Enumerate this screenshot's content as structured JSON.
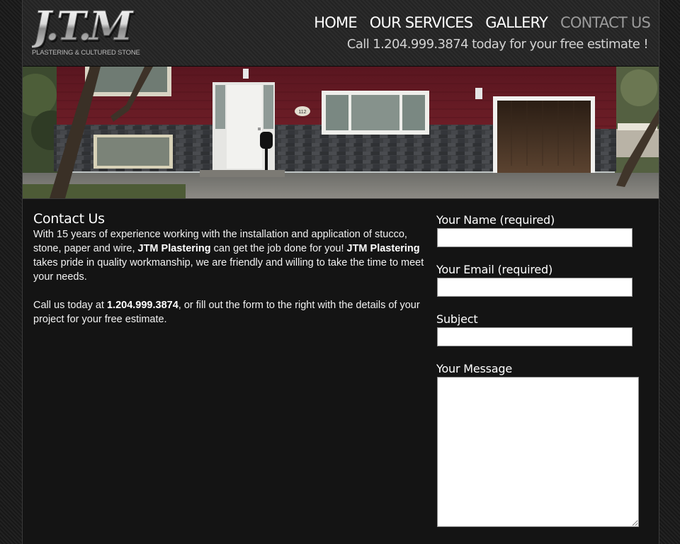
{
  "header": {
    "logo_text": "J.T.M",
    "logo_tagline": "PLASTERING & CULTURED STONE",
    "nav": [
      {
        "label": "HOME",
        "active": false
      },
      {
        "label": "OUR SERVICES",
        "active": false
      },
      {
        "label": "GALLERY",
        "active": false
      },
      {
        "label": "CONTACT US",
        "active": true
      }
    ],
    "phone_line": "Call 1.204.999.3874 today for your free estimate !"
  },
  "banner": {
    "image": "house-photo",
    "house_number": "112"
  },
  "content": {
    "title": "Contact Us",
    "para1": {
      "t1": "With 15 years of experience working with the installation and application of stucco, stone, paper and wire, ",
      "b1": "JTM Plastering",
      "t2": " can get the job done for you! ",
      "b2": "JTM Plastering",
      "t3": " takes pride in quality workmanship, we are friendly and willing to take the time to meet your needs."
    },
    "para2": {
      "t1": "Call us today at ",
      "b1": "1.204.999.3874",
      "t2": ", or fill out the form to the right with the details of your project for your free estimate."
    }
  },
  "form": {
    "name_label": "Your Name (required)",
    "name_value": "",
    "email_label": "Your Email (required)",
    "email_value": "",
    "subject_label": "Subject",
    "subject_value": "",
    "message_label": "Your Message",
    "message_value": ""
  },
  "colors": {
    "page_bg": "#141414",
    "header_bg": "#262626",
    "nav_text": "#ffffff",
    "nav_active": "#9a9a9a",
    "phone_text": "#d2d2d2",
    "body_text": "#f2f2f2"
  }
}
